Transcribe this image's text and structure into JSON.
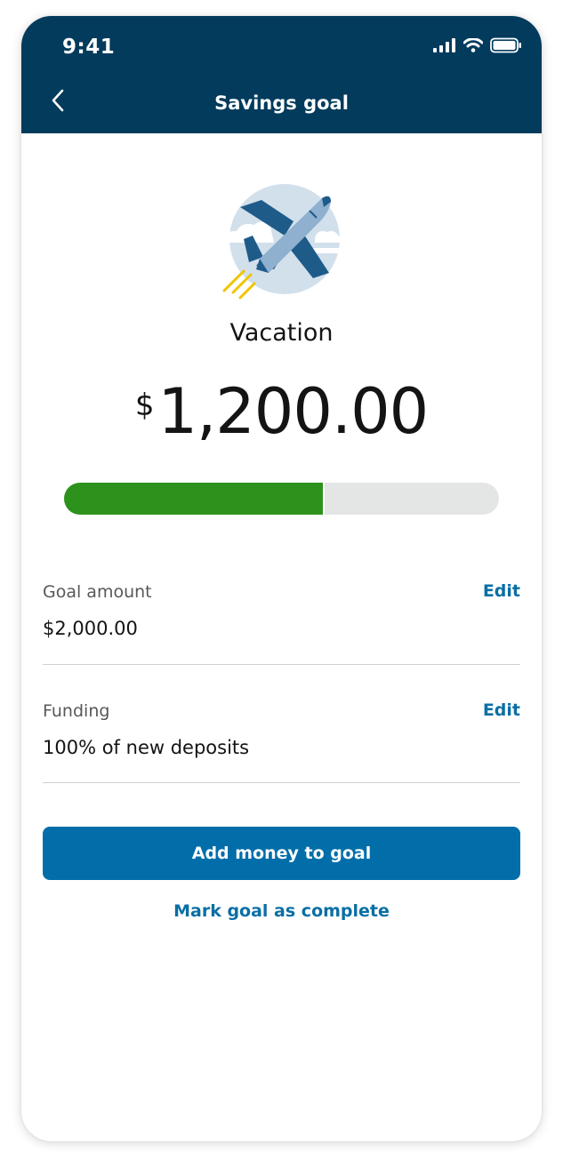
{
  "status_bar": {
    "time": "9:41",
    "icons": [
      "signal-icon",
      "wifi-icon",
      "battery-icon"
    ]
  },
  "header": {
    "title": "Savings goal",
    "back_icon": "chevron-left-icon",
    "background": "#023b5c"
  },
  "goal": {
    "illustration": "airplane-icon",
    "name": "Vacation",
    "currency_symbol": "$",
    "saved_amount": "1,200.00",
    "progress_fraction": 0.6,
    "progress_color": "#2c921b"
  },
  "details": [
    {
      "label": "Goal amount",
      "value": "$2,000.00",
      "edit_label": "Edit"
    },
    {
      "label": "Funding",
      "value": "100% of new deposits",
      "edit_label": "Edit"
    }
  ],
  "actions": {
    "primary_label": "Add money to goal",
    "secondary_label": "Mark goal as complete",
    "accent": "#016eaa"
  }
}
